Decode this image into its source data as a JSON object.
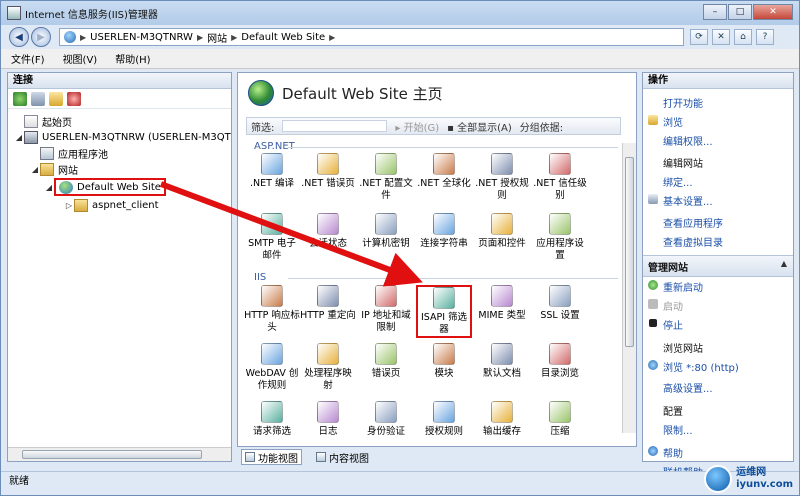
{
  "window": {
    "title": "Internet 信息服务(IIS)管理器",
    "controls": {
      "minimize": "–",
      "maximize": "□",
      "close": "✕"
    }
  },
  "address": {
    "breadcrumbs": [
      "USERLEN-M3QTNRW",
      "网站",
      "Default Web Site"
    ],
    "separator": "▶"
  },
  "menu": {
    "items": [
      "文件(F)",
      "视图(V)",
      "帮助(H)"
    ]
  },
  "connections": {
    "header": "连接",
    "tree": [
      {
        "label": "起始页",
        "icon": "start-page-icon",
        "expander": ""
      },
      {
        "label": "USERLEN-M3QTNRW (USERLEN-M3QT",
        "icon": "server-icon",
        "expander": "◢"
      },
      {
        "label": "应用程序池",
        "icon": "app-pool-icon",
        "expander": ""
      },
      {
        "label": "网站",
        "icon": "sites-folder-icon",
        "expander": "◢"
      },
      {
        "label": "Default Web Site",
        "icon": "website-globe-icon",
        "expander": "◢"
      },
      {
        "label": "aspnet_client",
        "icon": "folder-icon",
        "expander": "▷"
      }
    ]
  },
  "center": {
    "title": "Default Web Site 主页",
    "filter": {
      "label": "筛选:",
      "start": "开始(G)",
      "show_all": "全部显示(A)",
      "group_by": "分组依据:"
    },
    "groups": {
      "aspnet": "ASP.NET",
      "iis": "IIS"
    },
    "aspnet_features": [
      ".NET 编译",
      ".NET 错误页",
      ".NET 配置文件",
      ".NET 全球化",
      ".NET 授权规则",
      ".NET 信任级别",
      "SMTP 电子邮件",
      "会话状态",
      "计算机密钥",
      "连接字符串",
      "页面和控件",
      "应用程序设置"
    ],
    "iis_features": [
      "HTTP 响应标头",
      "HTTP 重定向",
      "IP 地址和域限制",
      "ISAPI 筛选器",
      "MIME 类型",
      "SSL 设置",
      "WebDAV 创作规则",
      "处理程序映射",
      "错误页",
      "模块",
      "默认文档",
      "目录浏览",
      "请求筛选",
      "日志",
      "身份验证",
      "授权规则",
      "输出缓存",
      "压缩"
    ],
    "view_tabs": [
      "功能视图",
      "内容视图"
    ]
  },
  "actions": {
    "header": "操作",
    "top_links": [
      "打开功能"
    ],
    "explore": [
      "浏览",
      "编辑权限..."
    ],
    "edit_site_title": "编辑网站",
    "edit_site_links": [
      "绑定...",
      "基本设置..."
    ],
    "app_links": [
      "查看应用程序",
      "查看虚拟目录"
    ],
    "manage_title": "管理网站",
    "manage_links": [
      "重新启动",
      "启动",
      "停止"
    ],
    "browse_title": "浏览网站",
    "browse_links": [
      "浏览 *:80 (http)"
    ],
    "advanced": "高级设置...",
    "config_title": "配置",
    "config_links": [
      "限制..."
    ],
    "help_links": [
      "帮助",
      "联机帮助"
    ]
  },
  "status": {
    "text": "就绪"
  },
  "watermark": {
    "name": "运维网",
    "url": "iyunv.com"
  },
  "colors": {
    "highlight_red": "#e01010",
    "link_blue": "#1a4fa8"
  }
}
